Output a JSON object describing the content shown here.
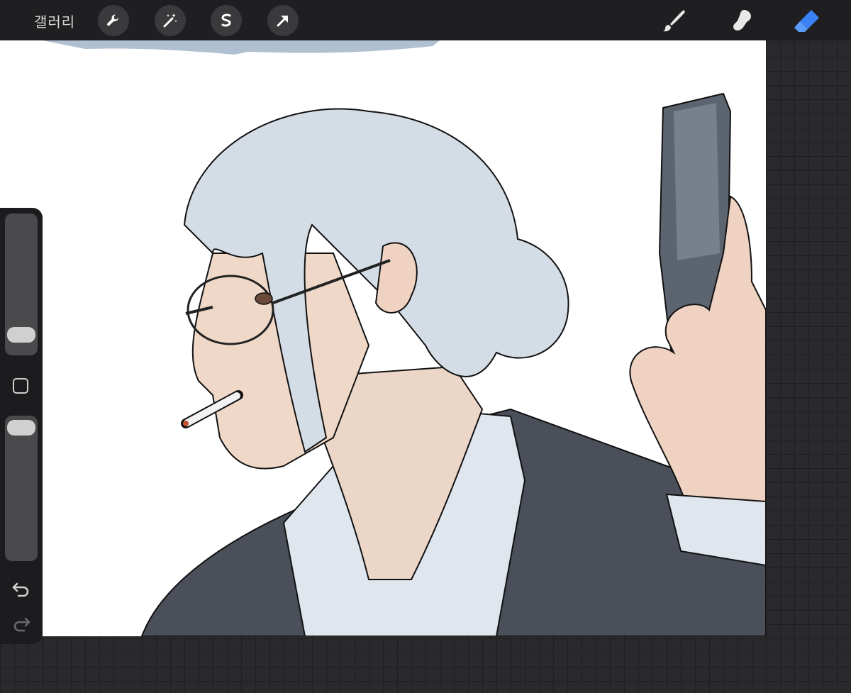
{
  "toolbar": {
    "gallery_label": "갤러리",
    "left_tools": [
      "wrench-icon",
      "magic-wand-icon",
      "selection-icon",
      "transform-arrow-icon"
    ],
    "right_tools": [
      "brush-icon",
      "smudge-icon",
      "eraser-icon"
    ],
    "active_tool": "eraser",
    "active_color": "#3b82f6"
  },
  "sidebar": {
    "controls": [
      "brush-size-slider",
      "modify-button",
      "opacity-slider",
      "undo-icon",
      "redo-icon"
    ]
  },
  "canvas": {
    "content": "artwork-illustration"
  }
}
